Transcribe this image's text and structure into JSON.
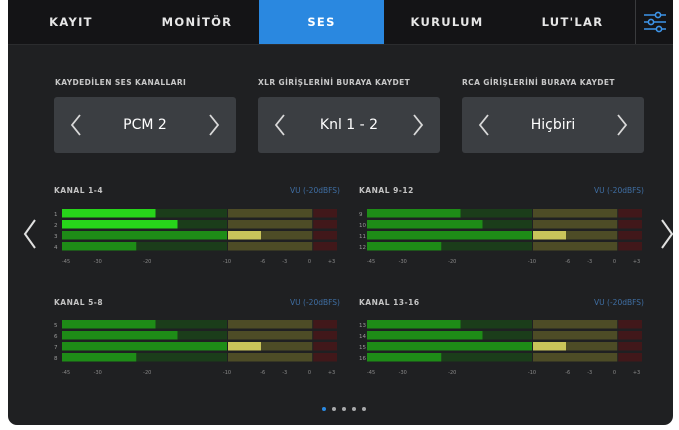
{
  "tabs": [
    "KAYIT",
    "MONİTÖR",
    "SES",
    "KURULUM",
    "LUT'LAR"
  ],
  "active_tab": "SES",
  "dropdowns": [
    {
      "label": "KAYDEDİLEN SES KANALLARI",
      "value": "PCM 2"
    },
    {
      "label": "XLR GİRİŞLERİNİ BURAYA KAYDET",
      "value": "Knl 1 - 2"
    },
    {
      "label": "RCA GİRİŞLERİNİ BURAYA KAYDET",
      "value": "Hiçbiri"
    }
  ],
  "meter_groups": [
    {
      "title": "KANAL 1-4",
      "vu": "VU (-20dBFS)",
      "channels": [
        "1",
        "2",
        "3",
        "4"
      ],
      "levels": [
        0.34,
        0.42,
        0.72,
        0.27
      ]
    },
    {
      "title": "KANAL 9-12",
      "vu": "VU (-20dBFS)",
      "channels": [
        "9",
        "10",
        "11",
        "12"
      ],
      "levels": [
        0.34,
        0.42,
        0.72,
        0.27
      ]
    },
    {
      "title": "KANAL 5-8",
      "vu": "VU (-20dBFS)",
      "channels": [
        "5",
        "6",
        "7",
        "8"
      ],
      "levels": [
        0.34,
        0.42,
        0.72,
        0.27
      ]
    },
    {
      "title": "KANAL 13-16",
      "vu": "VU (-20dBFS)",
      "channels": [
        "13",
        "14",
        "15",
        "16"
      ],
      "levels": [
        0.34,
        0.42,
        0.72,
        0.27
      ]
    }
  ],
  "scale_labels": [
    "-45",
    "-30",
    "-20",
    "-10",
    "-6",
    "-3",
    "0",
    "+3"
  ],
  "page_count": 5,
  "active_page": 1,
  "colors": {
    "accent": "#2a88e0",
    "meter_bright": "#27d51a",
    "meter_mid": "#1e8c17",
    "meter_yellow_zone": "#4d4c26",
    "meter_red_zone": "#41181a",
    "peak": "#c9c45a"
  }
}
